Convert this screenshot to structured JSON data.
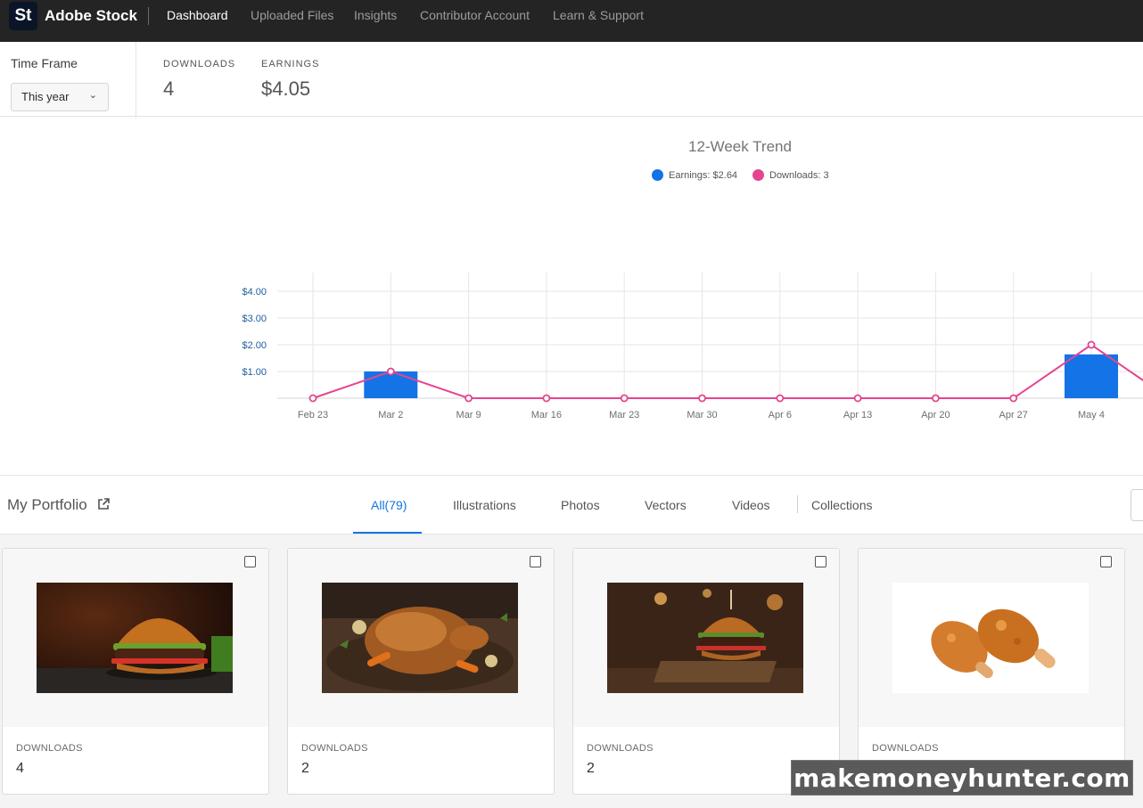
{
  "header": {
    "logo_text": "St",
    "brand": "Adobe Stock",
    "nav": [
      {
        "label": "Dashboard",
        "active": true
      },
      {
        "label": "Uploaded Files",
        "active": false
      },
      {
        "label": "Insights",
        "active": false
      },
      {
        "label": "Contributor Account",
        "active": false
      },
      {
        "label": "Learn & Support",
        "active": false
      }
    ]
  },
  "filters": {
    "time_frame_label": "Time Frame",
    "time_frame_value": "This year"
  },
  "stats": {
    "downloads_label": "DOWNLOADS",
    "downloads_value": "4",
    "earnings_label": "EARNINGS",
    "earnings_value": "$4.05"
  },
  "chart_data": {
    "type": "bar",
    "title": "12-Week Trend",
    "legend": [
      {
        "label": "Earnings: $2.64",
        "color": "#1473e6"
      },
      {
        "label": "Downloads: 3",
        "color": "#e5458f"
      }
    ],
    "categories": [
      "Feb 23",
      "Mar 2",
      "Mar 9",
      "Mar 16",
      "Mar 23",
      "Mar 30",
      "Apr 6",
      "Apr 13",
      "Apr 20",
      "Apr 27",
      "May 4"
    ],
    "series": [
      {
        "name": "Earnings: $2.64",
        "kind": "bar",
        "color": "#1473e6",
        "values": [
          0,
          1.0,
          0,
          0,
          0,
          0,
          0,
          0,
          0,
          0,
          1.64
        ]
      },
      {
        "name": "Downloads: 3",
        "kind": "line",
        "color": "#e5458f",
        "values": [
          0,
          1,
          0,
          0,
          0,
          0,
          0,
          0,
          0,
          0,
          2
        ]
      }
    ],
    "y_ticks": [
      "$1.00",
      "$2.00",
      "$3.00",
      "$4.00"
    ],
    "ylim": [
      0,
      4
    ],
    "grid": true,
    "legend_position": "top-center"
  },
  "portfolio": {
    "title": "My Portfolio",
    "tabs": [
      {
        "label": "All(79)",
        "active": true
      },
      {
        "label": "Illustrations",
        "active": false
      },
      {
        "label": "Photos",
        "active": false
      },
      {
        "label": "Vectors",
        "active": false
      },
      {
        "label": "Videos",
        "active": false
      },
      {
        "label": "Collections",
        "active": false
      }
    ],
    "cards": [
      {
        "image": "burger-image",
        "downloads_label": "DOWNLOADS",
        "downloads": "4"
      },
      {
        "image": "roast-chicken-image",
        "downloads_label": "DOWNLOADS",
        "downloads": "2"
      },
      {
        "image": "burger-on-board-image",
        "downloads_label": "DOWNLOADS",
        "downloads": "2"
      },
      {
        "image": "fried-chicken-image",
        "downloads_label": "DOWNLOADS",
        "downloads": ""
      }
    ]
  },
  "watermark": "makemoneyhunter.com"
}
